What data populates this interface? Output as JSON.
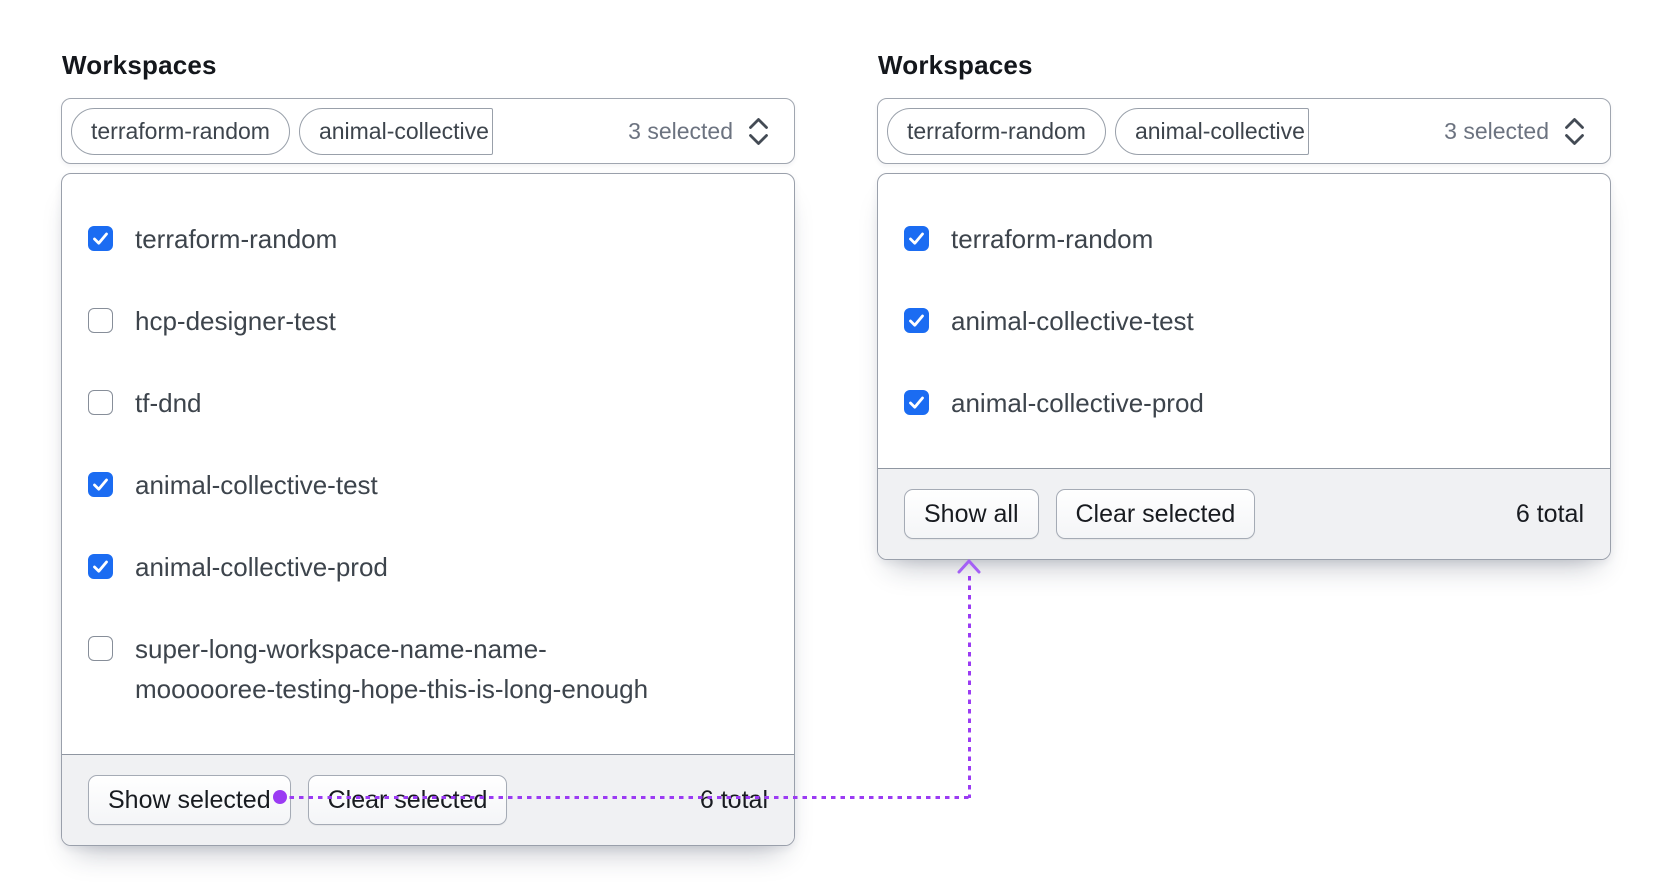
{
  "colors": {
    "checkbox_blue": "#1b6cf2",
    "arrow_purple": "#9b3bf3",
    "arrowhead_purple": "#a45ff5",
    "footer_bg": "#f0f1f3",
    "border_gray": "#9aa0ab"
  },
  "panels": [
    {
      "label": "Workspaces",
      "select": {
        "pills": [
          "terraform-random",
          "animal-collective"
        ],
        "pill_truncated_index": 1,
        "summary": "3 selected",
        "chevron_icon": "up-down-chevrons"
      },
      "items": [
        {
          "label": "terraform-random",
          "checked": true
        },
        {
          "label": "hcp-designer-test",
          "checked": false
        },
        {
          "label": "tf-dnd",
          "checked": false
        },
        {
          "label": "animal-collective-test",
          "checked": true
        },
        {
          "label": "animal-collective-prod",
          "checked": true
        },
        {
          "label": "super-long-workspace-name-name-\nmoooooree-testing-hope-this-is-long-enough",
          "checked": false
        }
      ],
      "footer": {
        "buttons": [
          "Show selected",
          "Clear selected"
        ],
        "total": "6 total"
      }
    },
    {
      "label": "Workspaces",
      "select": {
        "pills": [
          "terraform-random",
          "animal-collective"
        ],
        "pill_truncated_index": 1,
        "summary": "3 selected",
        "chevron_icon": "up-down-chevrons"
      },
      "items": [
        {
          "label": "terraform-random",
          "checked": true
        },
        {
          "label": "animal-collective-test",
          "checked": true
        },
        {
          "label": "animal-collective-prod",
          "checked": true
        }
      ],
      "footer": {
        "buttons": [
          "Show all",
          "Clear selected"
        ],
        "total": "6 total"
      }
    }
  ],
  "annotation_arrow": {
    "type": "dotted-flow-arrow",
    "from_label": "Show selected",
    "to_label": "Show all",
    "color": "#9b3bf3"
  }
}
